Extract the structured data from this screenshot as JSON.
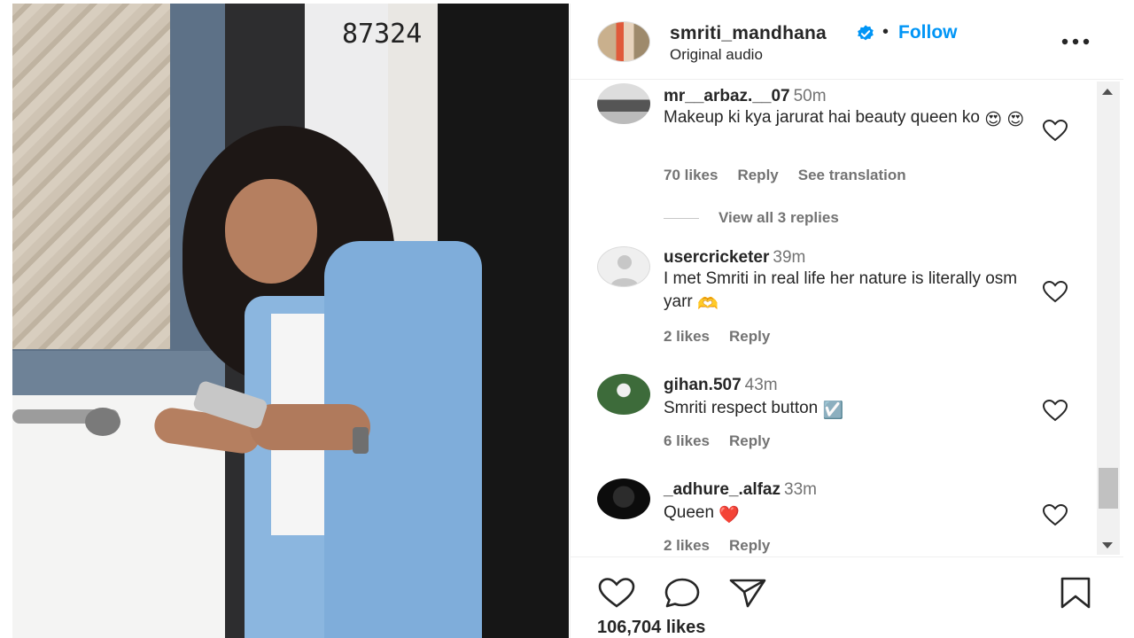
{
  "post": {
    "author": "smriti_mandhana",
    "follow_label": "Follow",
    "separator": "•",
    "audio": "Original audio",
    "house_number": "87324"
  },
  "comments": [
    {
      "username": "mr__arbaz.__07",
      "time": "50m",
      "text": "Makeup ki kya jarurat hai beauty queen ko",
      "emoji": "😍 😍",
      "likes": "70 likes",
      "reply_label": "Reply",
      "translate_label": "See translation",
      "view_replies": "View all 3 replies"
    },
    {
      "username": "usercricketer",
      "time": "39m",
      "text": "I met Smriti in real life her nature is literally osm yarr",
      "emoji": "🫶",
      "likes": "2 likes",
      "reply_label": "Reply"
    },
    {
      "username": "gihan.507",
      "time": "43m",
      "text": "Smriti respect button",
      "emoji": "☑️",
      "likes": "6 likes",
      "reply_label": "Reply"
    },
    {
      "username": "_adhure_.alfaz",
      "time": "33m",
      "text": "Queen",
      "emoji": "❤️",
      "likes": "2 likes",
      "reply_label": "Reply"
    }
  ],
  "footer": {
    "likes": "106,704 likes"
  },
  "icons": {
    "verified": "verified-badge-icon",
    "more": "more-options-icon",
    "like": "heart-icon",
    "comment": "comment-bubble-icon",
    "share": "paper-plane-icon",
    "save": "bookmark-icon"
  },
  "colors": {
    "accent": "#0095f6",
    "text": "#262626",
    "muted": "#737373",
    "heart_emoji": "#e0245e"
  }
}
